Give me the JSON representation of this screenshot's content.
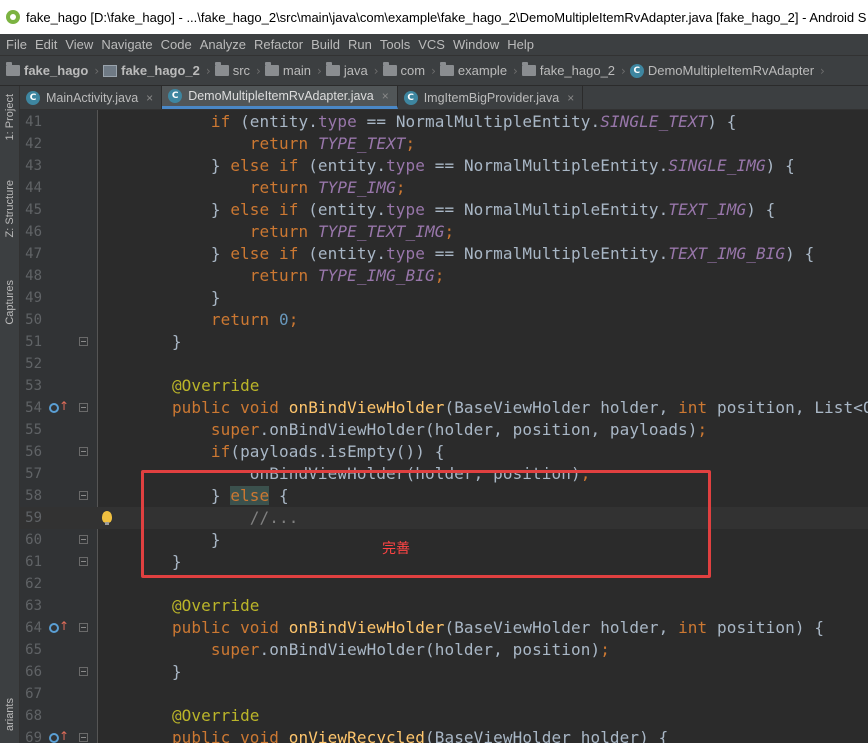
{
  "window": {
    "title": "fake_hago [D:\\fake_hago] - ...\\fake_hago_2\\src\\main\\java\\com\\example\\fake_hago_2\\DemoMultipleItemRvAdapter.java [fake_hago_2] - Android S"
  },
  "menu": [
    "File",
    "Edit",
    "View",
    "Navigate",
    "Code",
    "Analyze",
    "Refactor",
    "Build",
    "Run",
    "Tools",
    "VCS",
    "Window",
    "Help"
  ],
  "breadcrumbs": [
    {
      "label": "fake_hago",
      "icon": "folder-icon",
      "bold": true
    },
    {
      "label": "fake_hago_2",
      "icon": "module-icon",
      "bold": true
    },
    {
      "label": "src",
      "icon": "folder-icon",
      "bold": false
    },
    {
      "label": "main",
      "icon": "folder-icon",
      "bold": false
    },
    {
      "label": "java",
      "icon": "folder-icon",
      "bold": false
    },
    {
      "label": "com",
      "icon": "package-icon",
      "bold": false
    },
    {
      "label": "example",
      "icon": "package-icon",
      "bold": false
    },
    {
      "label": "fake_hago_2",
      "icon": "package-icon",
      "bold": false
    },
    {
      "label": "DemoMultipleItemRvAdapter",
      "icon": "class-icon",
      "bold": false
    }
  ],
  "left_tools": {
    "project": "1: Project",
    "structure": "Z: Structure",
    "captures": "Captures",
    "variants": "ariants"
  },
  "tabs": [
    {
      "label": "MainActivity.java",
      "active": false,
      "close": "×"
    },
    {
      "label": "DemoMultipleItemRvAdapter.java",
      "active": true,
      "close": "×"
    },
    {
      "label": "ImgItemBigProvider.java",
      "active": false,
      "close": "×"
    }
  ],
  "class_icon_letter": "C",
  "editor": {
    "caret_line": 59,
    "lines": [
      {
        "n": "41",
        "tokens": [
          [
            "",
            "        "
          ],
          [
            "kw",
            "if"
          ],
          [
            "",
            " (entity."
          ],
          [
            "fld",
            "type"
          ],
          [
            "",
            " == NormalMultipleEntity."
          ],
          [
            "const",
            "SINGLE_TEXT"
          ],
          [
            "",
            ") {"
          ]
        ]
      },
      {
        "n": "42",
        "tokens": [
          [
            "",
            "            "
          ],
          [
            "kw",
            "return"
          ],
          [
            "",
            " "
          ],
          [
            "const",
            "TYPE_TEXT"
          ],
          [
            "kw",
            ";"
          ]
        ]
      },
      {
        "n": "43",
        "tokens": [
          [
            "",
            "        } "
          ],
          [
            "kw",
            "else if"
          ],
          [
            "",
            " (entity."
          ],
          [
            "fld",
            "type"
          ],
          [
            "",
            " == NormalMultipleEntity."
          ],
          [
            "const",
            "SINGLE_IMG"
          ],
          [
            "",
            ") {"
          ]
        ]
      },
      {
        "n": "44",
        "tokens": [
          [
            "",
            "            "
          ],
          [
            "kw",
            "return"
          ],
          [
            "",
            " "
          ],
          [
            "const",
            "TYPE_IMG"
          ],
          [
            "kw",
            ";"
          ]
        ]
      },
      {
        "n": "45",
        "tokens": [
          [
            "",
            "        } "
          ],
          [
            "kw",
            "else if"
          ],
          [
            "",
            " (entity."
          ],
          [
            "fld",
            "type"
          ],
          [
            "",
            " == NormalMultipleEntity."
          ],
          [
            "const",
            "TEXT_IMG"
          ],
          [
            "",
            ") {"
          ]
        ]
      },
      {
        "n": "46",
        "tokens": [
          [
            "",
            "            "
          ],
          [
            "kw",
            "return"
          ],
          [
            "",
            " "
          ],
          [
            "const",
            "TYPE_TEXT_IMG"
          ],
          [
            "kw",
            ";"
          ]
        ]
      },
      {
        "n": "47",
        "tokens": [
          [
            "",
            "        } "
          ],
          [
            "kw",
            "else if"
          ],
          [
            "",
            " (entity."
          ],
          [
            "fld",
            "type"
          ],
          [
            "",
            " == NormalMultipleEntity."
          ],
          [
            "const",
            "TEXT_IMG_BIG"
          ],
          [
            "",
            ") {"
          ]
        ]
      },
      {
        "n": "48",
        "tokens": [
          [
            "",
            "            "
          ],
          [
            "kw",
            "return"
          ],
          [
            "",
            " "
          ],
          [
            "const",
            "TYPE_IMG_BIG"
          ],
          [
            "kw",
            ";"
          ]
        ]
      },
      {
        "n": "49",
        "tokens": [
          [
            "",
            "        }"
          ]
        ]
      },
      {
        "n": "50",
        "tokens": [
          [
            "",
            "        "
          ],
          [
            "kw",
            "return"
          ],
          [
            "",
            " "
          ],
          [
            "num",
            "0"
          ],
          [
            "kw",
            ";"
          ]
        ]
      },
      {
        "n": "51",
        "tokens": [
          [
            "",
            "    }"
          ]
        ],
        "fold": true
      },
      {
        "n": "52",
        "tokens": []
      },
      {
        "n": "53",
        "tokens": [
          [
            "",
            "    "
          ],
          [
            "ann",
            "@Override"
          ]
        ]
      },
      {
        "n": "54",
        "tokens": [
          [
            "",
            "    "
          ],
          [
            "kw",
            "public void"
          ],
          [
            "",
            " "
          ],
          [
            "fn",
            "onBindViewHolder"
          ],
          [
            "",
            "(BaseViewHolder holder, "
          ],
          [
            "kw",
            "int"
          ],
          [
            "",
            " position, List<Obj"
          ]
        ],
        "override": true,
        "fold": true
      },
      {
        "n": "55",
        "tokens": [
          [
            "",
            "        "
          ],
          [
            "kw",
            "super"
          ],
          [
            "",
            ".onBindViewHolder(holder, position, payloads)"
          ],
          [
            "kw",
            ";"
          ]
        ]
      },
      {
        "n": "56",
        "tokens": [
          [
            "",
            "        "
          ],
          [
            "kw",
            "if"
          ],
          [
            "",
            "(payloads.isEmpty()) {"
          ]
        ],
        "fold": true
      },
      {
        "n": "57",
        "tokens": [
          [
            "",
            "            onBindViewHolder(holder, position)"
          ],
          [
            "kw",
            ";"
          ]
        ]
      },
      {
        "n": "58",
        "tokens": [
          [
            "",
            "        } "
          ],
          [
            "hl",
            "else"
          ],
          [
            "",
            " {"
          ]
        ],
        "fold": true
      },
      {
        "n": "59",
        "tokens": [
          [
            "",
            "            "
          ],
          [
            "cmt",
            "//..."
          ]
        ],
        "bulb": true
      },
      {
        "n": "60",
        "tokens": [
          [
            "",
            "        }"
          ]
        ],
        "fold": true
      },
      {
        "n": "61",
        "tokens": [
          [
            "",
            "    }"
          ]
        ],
        "fold": true
      },
      {
        "n": "62",
        "tokens": []
      },
      {
        "n": "63",
        "tokens": [
          [
            "",
            "    "
          ],
          [
            "ann",
            "@Override"
          ]
        ]
      },
      {
        "n": "64",
        "tokens": [
          [
            "",
            "    "
          ],
          [
            "kw",
            "public void"
          ],
          [
            "",
            " "
          ],
          [
            "fn",
            "onBindViewHolder"
          ],
          [
            "",
            "(BaseViewHolder holder, "
          ],
          [
            "kw",
            "int"
          ],
          [
            "",
            " position) {"
          ]
        ],
        "override": true,
        "fold": true
      },
      {
        "n": "65",
        "tokens": [
          [
            "",
            "        "
          ],
          [
            "kw",
            "super"
          ],
          [
            "",
            ".onBindViewHolder(holder, position)"
          ],
          [
            "kw",
            ";"
          ]
        ]
      },
      {
        "n": "66",
        "tokens": [
          [
            "",
            "    }"
          ]
        ],
        "fold": true
      },
      {
        "n": "67",
        "tokens": []
      },
      {
        "n": "68",
        "tokens": [
          [
            "",
            "    "
          ],
          [
            "ann",
            "@Override"
          ]
        ]
      },
      {
        "n": "69",
        "tokens": [
          [
            "",
            "    "
          ],
          [
            "kw",
            "public void"
          ],
          [
            "",
            " "
          ],
          [
            "fn",
            "onViewRecycled"
          ],
          [
            "",
            "(BaseViewHolder holder) {"
          ]
        ],
        "override": true,
        "fold": true
      }
    ]
  },
  "annotation": {
    "note": "完善",
    "color": "#e04040"
  }
}
